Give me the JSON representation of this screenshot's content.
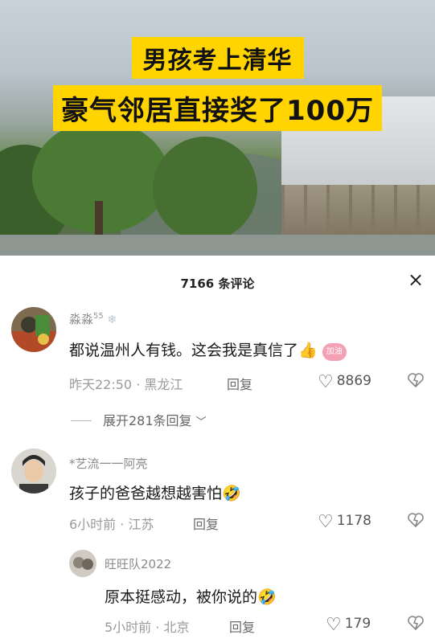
{
  "video": {
    "caption_line1": "男孩考上清华",
    "caption_line2": "豪气邻居直接奖了100万"
  },
  "comments_header": {
    "title": "7166 条评论",
    "close_icon": "×"
  },
  "comments": [
    {
      "username": "淼淼",
      "badge": "55",
      "text": "都说温州人有钱。这会我是真信了👍",
      "sticker": "加油",
      "time": "昨天22:50",
      "location": "黑龙江",
      "reply_label": "回复",
      "likes": "8869",
      "expand_label": "展开281条回复"
    },
    {
      "username": "*艺流一一阿亮",
      "text": "孩子的爸爸越想越害怕🤣",
      "time": "6小时前",
      "location": "江苏",
      "reply_label": "回复",
      "likes": "1178"
    }
  ],
  "reply": {
    "username": "旺旺队2022",
    "text": "原本挺感动，被你说的🤣",
    "time": "5小时前",
    "location": "北京",
    "reply_label": "回复",
    "likes": "179"
  },
  "colors": {
    "caption_bg": "#ffd400",
    "text_primary": "#1a1a1a",
    "text_secondary": "#9a9a9a"
  }
}
